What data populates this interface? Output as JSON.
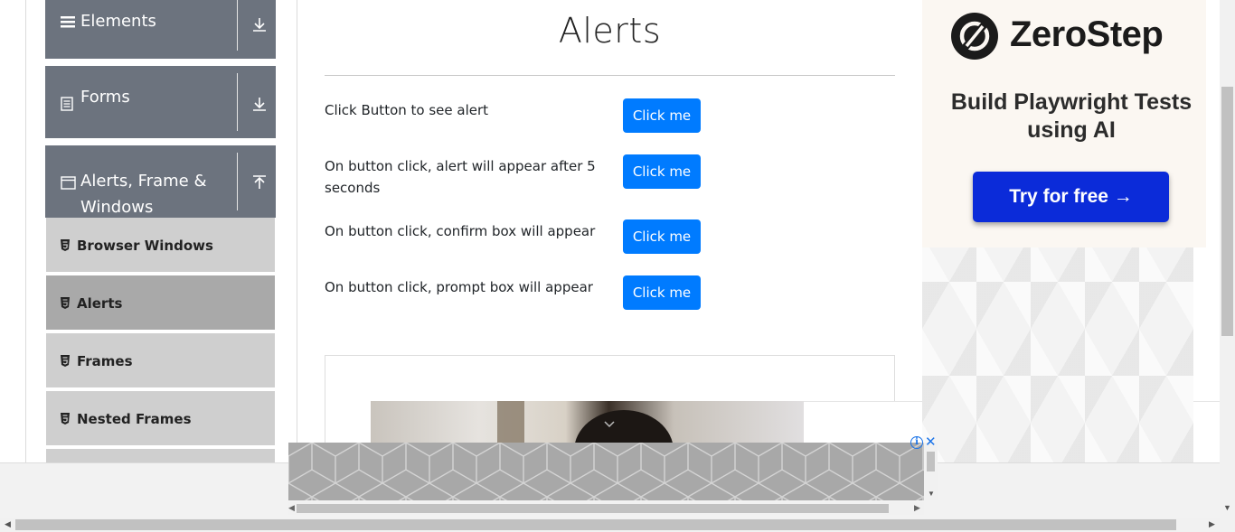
{
  "sidebar": {
    "groups": [
      {
        "label": "Elements",
        "icon": "hamburger-icon",
        "state": "collapsed"
      },
      {
        "label": "Forms",
        "icon": "document-icon",
        "state": "collapsed"
      },
      {
        "label": "Alerts, Frame & Windows",
        "icon": "window-icon",
        "state": "expanded"
      }
    ],
    "subitems": [
      {
        "label": "Browser Windows",
        "active": false
      },
      {
        "label": "Alerts",
        "active": true
      },
      {
        "label": "Frames",
        "active": false
      },
      {
        "label": "Nested Frames",
        "active": false
      }
    ]
  },
  "main": {
    "title": "Alerts",
    "rows": [
      {
        "label": "Click Button to see alert",
        "button": "Click me"
      },
      {
        "label": "On button click, alert will appear after 5 seconds",
        "button": "Click me"
      },
      {
        "label": "On button click, confirm box will appear",
        "button": "Click me"
      },
      {
        "label": "On button click, prompt box will appear",
        "button": "Click me"
      }
    ]
  },
  "ad": {
    "brand": "ZeroStep",
    "headline": "Build Playwright Tests using AI",
    "cta": "Try for free →",
    "info_glyph": "i",
    "close_glyph": "✕"
  },
  "colors": {
    "sidebar_group": "#6c737e",
    "submenu": "#cfcfcf",
    "submenu_active": "#a9a9a9",
    "primary_button": "#007bff",
    "ad_cta": "#0b2bd9"
  }
}
